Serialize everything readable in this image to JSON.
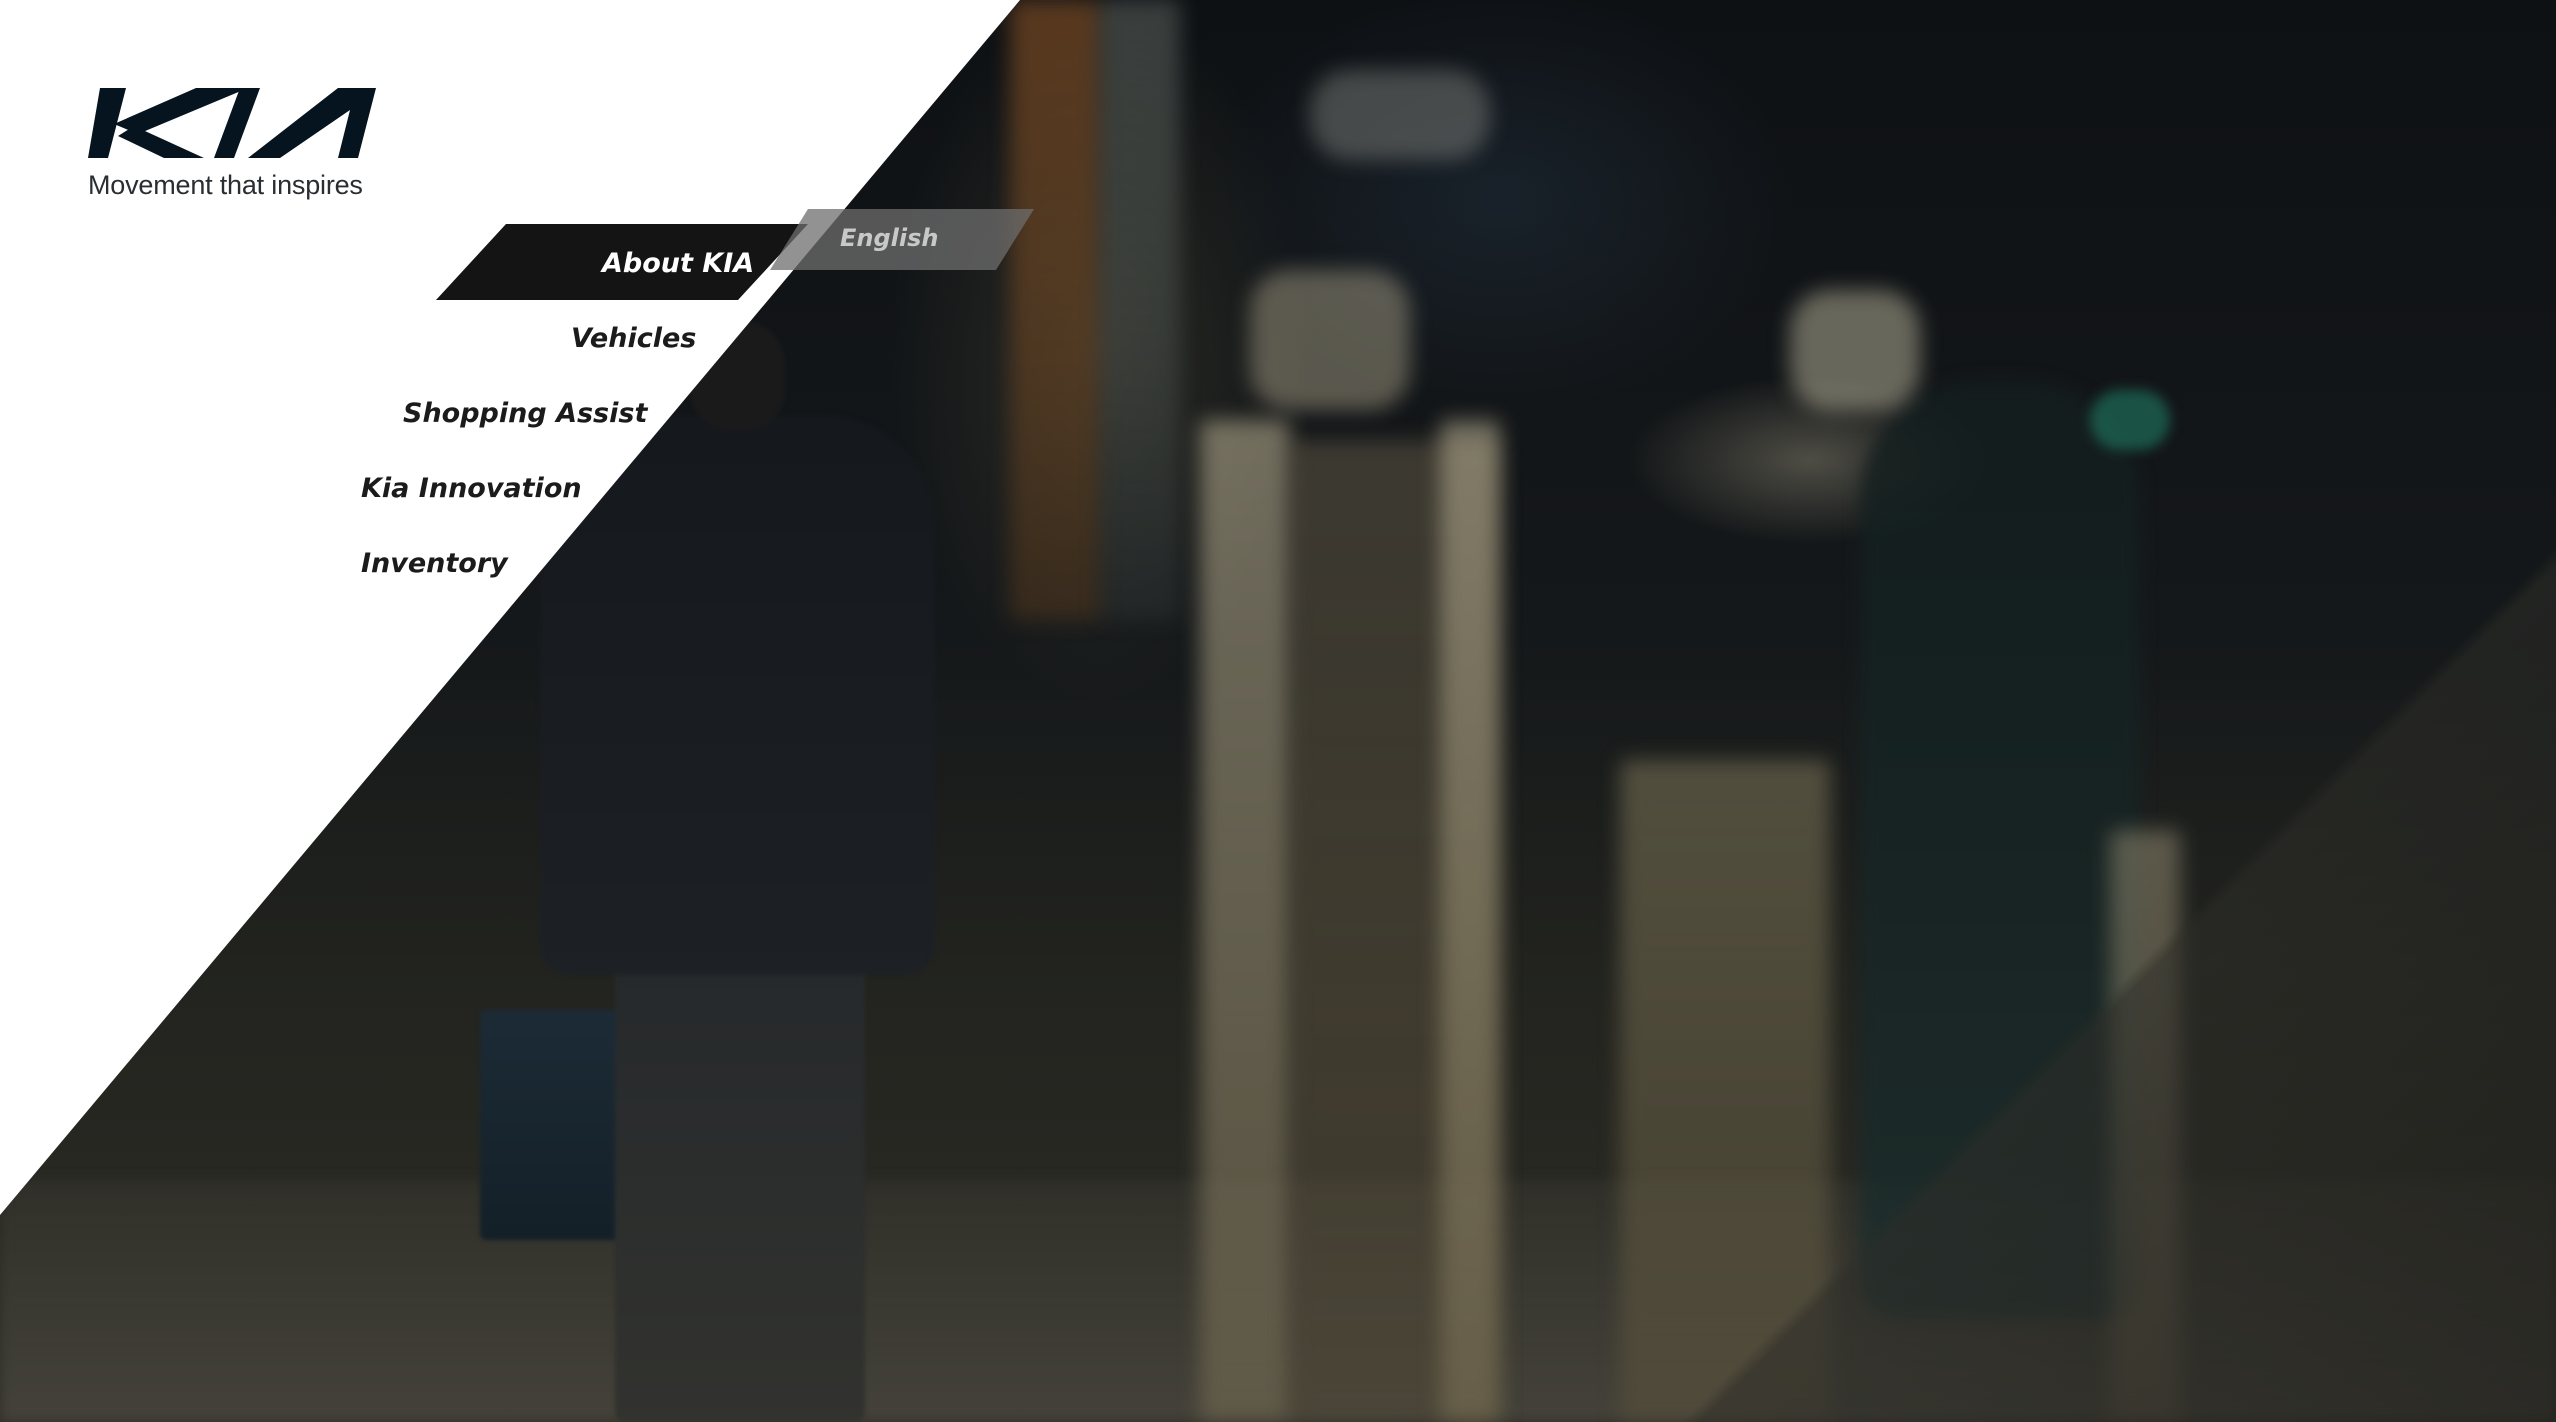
{
  "brand": {
    "logo_text": "KIA",
    "tagline": "Movement that inspires",
    "color": "#05141F"
  },
  "nav": {
    "items": [
      {
        "label": "About KIA",
        "active": true
      },
      {
        "label": "Vehicles",
        "active": false
      },
      {
        "label": "Shopping Assist",
        "active": false
      },
      {
        "label": "Kia Innovation",
        "active": false
      },
      {
        "label": "Inventory",
        "active": false
      }
    ]
  },
  "language": {
    "label": "English"
  },
  "colors": {
    "panel": "#ffffff",
    "active_bg": "#141414",
    "active_text": "#ffffff",
    "nav_text": "#1b1b1b"
  }
}
